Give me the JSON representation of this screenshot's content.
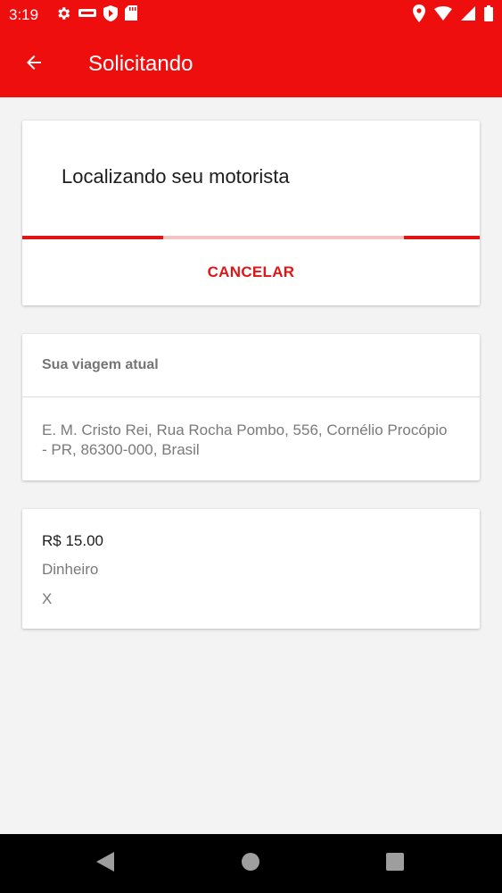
{
  "status_bar": {
    "time": "3:19",
    "left_icons": [
      "gear-icon",
      "app-badge-icon",
      "shield-play-icon",
      "sd-card-icon"
    ],
    "right_icons": [
      "location-pin-icon",
      "wifi-icon",
      "cell-signal-icon",
      "battery-icon"
    ]
  },
  "app_bar": {
    "title": "Solicitando",
    "back_icon": "arrow-back-icon"
  },
  "request_card": {
    "message": "Localizando seu motorista",
    "cancel_label": "CANCELAR"
  },
  "trip_card": {
    "header": "Sua viagem atual",
    "address": "E. M. Cristo Rei, Rua Rocha Pombo, 556, Cornélio Procópio - PR, 86300-000, Brasil"
  },
  "payment_card": {
    "price": "R$ 15.00",
    "method": "Dinheiro",
    "extra": "X"
  },
  "nav_bar": {
    "buttons": [
      "back-triangle-icon",
      "home-circle-icon",
      "recents-square-icon"
    ]
  },
  "colors": {
    "primary": "#ef0e0e",
    "accent": "#e01616",
    "progress_track": "#f6c3c3",
    "background": "#f4f3f3"
  }
}
